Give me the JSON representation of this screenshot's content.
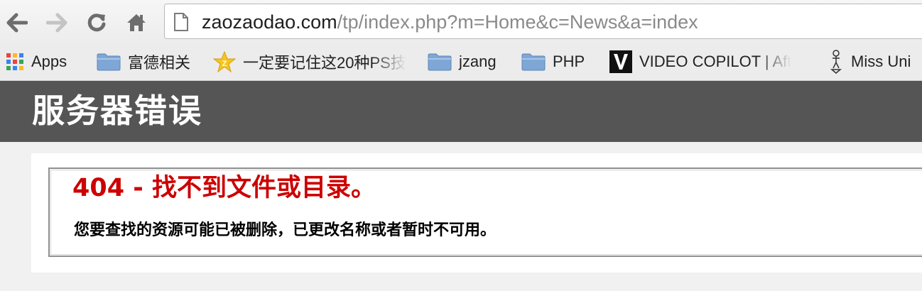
{
  "browser": {
    "url_domain": "zaozaodao.com",
    "url_path": "/tp/index.php?m=Home&c=News&a=index"
  },
  "bookmarks": [
    {
      "label": "Apps",
      "icon": "apps-grid-icon"
    },
    {
      "label": "富德相关",
      "icon": "folder-icon"
    },
    {
      "label": "一定要记住这20种PS技",
      "icon": "star-icon"
    },
    {
      "label": "jzang",
      "icon": "folder-icon"
    },
    {
      "label": "PHP",
      "icon": "folder-icon"
    },
    {
      "label": "VIDEO COPILOT | Aft",
      "icon": "video-copilot-icon"
    },
    {
      "label": "Miss Uni",
      "icon": "figure-icon"
    }
  ],
  "page": {
    "header_title": "服务器错误",
    "error_title": "404 - 找不到文件或目录。",
    "error_description": "您要查找的资源可能已被删除，已更改名称或者暂时不可用。"
  },
  "colors": {
    "header_bg": "#555555",
    "error_red": "#cc0000",
    "folder_blue": "#7fa7d6"
  }
}
